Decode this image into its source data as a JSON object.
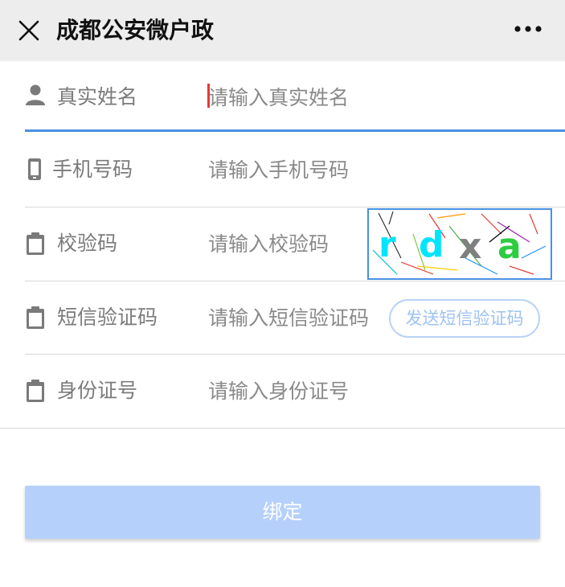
{
  "navbar": {
    "title": "成都公安微户政",
    "close_icon": "close-icon",
    "more_icon": "more-icon"
  },
  "form": {
    "name": {
      "label": "真实姓名",
      "placeholder": "请输入真实姓名",
      "icon": "user-icon"
    },
    "phone": {
      "label": "手机号码",
      "placeholder": "请输入手机号码",
      "icon": "mobile-icon"
    },
    "captcha": {
      "label": "校验码",
      "placeholder": "请输入校验码",
      "icon": "clipboard-icon",
      "image_text": "rdxa"
    },
    "sms": {
      "label": "短信验证码",
      "placeholder": "请输入短信验证码",
      "icon": "clipboard-icon",
      "send_button": "发送短信验证码"
    },
    "idcard": {
      "label": "身份证号",
      "placeholder": "请输入身份证号",
      "icon": "clipboard-icon"
    }
  },
  "actions": {
    "bind_label": "绑定"
  },
  "colors": {
    "accent": "#4a90e2",
    "button_bg": "#b5d0fb",
    "navbar_bg": "#ededed",
    "caret": "#e53935"
  }
}
